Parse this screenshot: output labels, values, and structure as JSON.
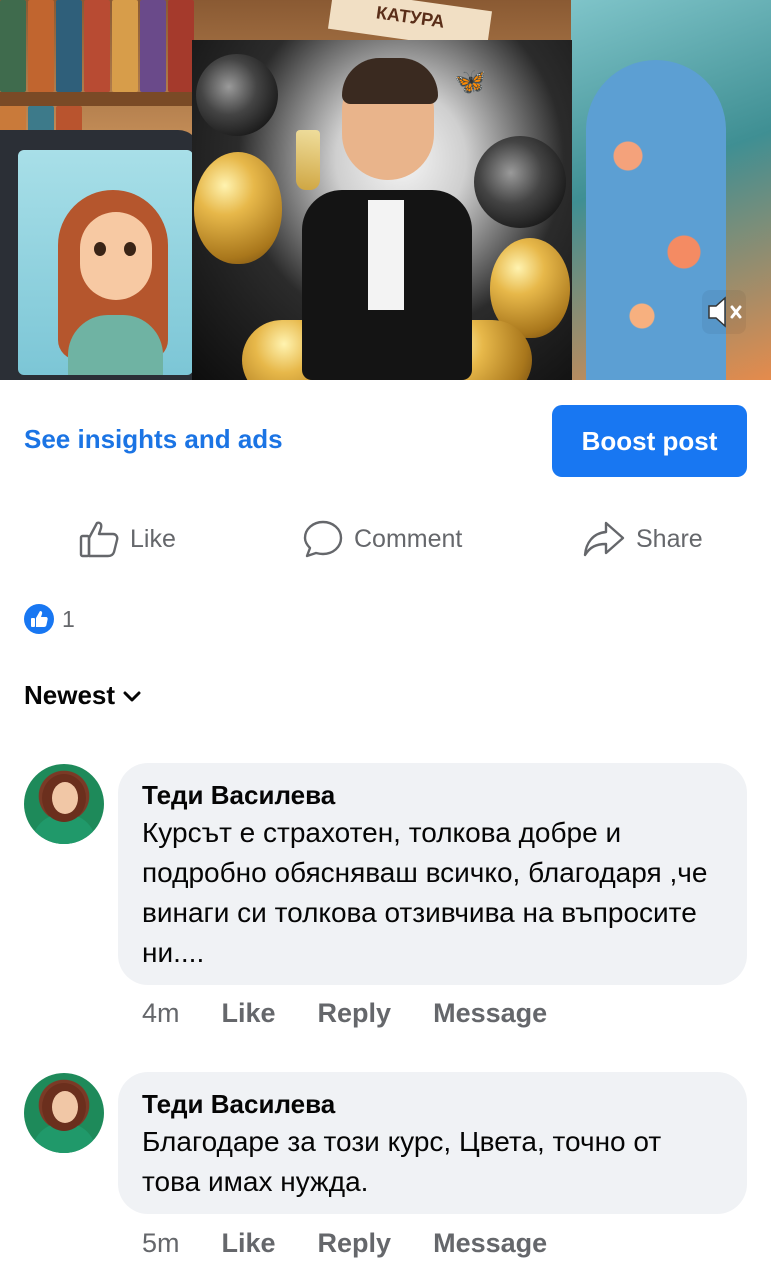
{
  "media": {
    "sign_text": "КАТУРА"
  },
  "post_actions": {
    "insights_label": "See insights and ads",
    "boost_label": "Boost post",
    "like_label": "Like",
    "comment_label": "Comment",
    "share_label": "Share"
  },
  "reactions": {
    "count": "1"
  },
  "sort": {
    "label": "Newest"
  },
  "comments": [
    {
      "author": "Теди Василева",
      "text": "Курсът е страхотен, толкова добре и подробно обясняваш всичко, благодаря ,че винаги си толкова отзивчива на въпросите ни....",
      "time": "4m",
      "like_label": "Like",
      "reply_label": "Reply",
      "message_label": "Message"
    },
    {
      "author": "Теди Василева",
      "text": "Благодаре за този курс, Цвета, точно от това имах нужда.",
      "time": "5m",
      "like_label": "Like",
      "reply_label": "Reply",
      "message_label": "Message"
    }
  ],
  "colors": {
    "accent": "#1877f2",
    "link": "#1b74e4",
    "muted": "#65676b",
    "bubble": "#f0f2f5"
  }
}
